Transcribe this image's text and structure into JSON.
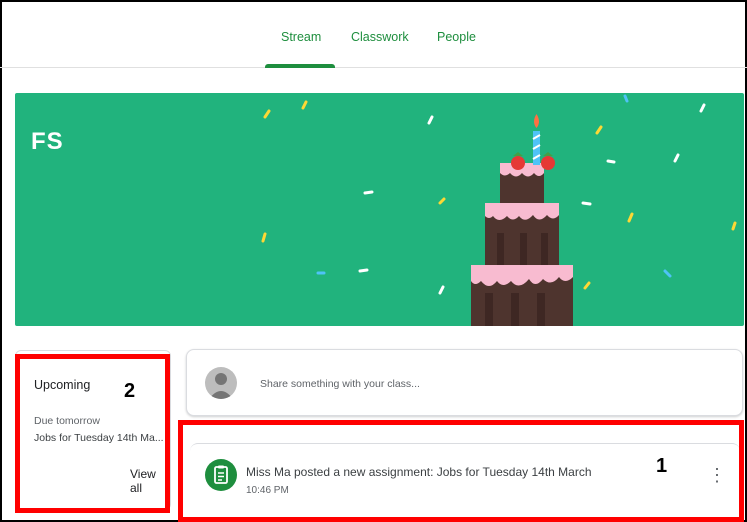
{
  "tabs": [
    {
      "label": "Stream",
      "active": true
    },
    {
      "label": "Classwork",
      "active": false
    },
    {
      "label": "People",
      "active": false
    }
  ],
  "banner": {
    "title": "FS",
    "color": "#21b37d"
  },
  "upcoming": {
    "title": "Upcoming",
    "due_label": "Due tomorrow",
    "item": "Jobs for Tuesday 14th Ma...",
    "view_all": "View all"
  },
  "share": {
    "placeholder": "Share something with your class..."
  },
  "post": {
    "title": "Miss Ma posted a new assignment: Jobs for Tuesday 14th March",
    "time": "10:46 PM",
    "icon": "assignment-icon"
  },
  "annotations": {
    "label_1": "1",
    "label_2": "2",
    "color": "#ff0000"
  },
  "colors": {
    "accent": "#1e8e3e",
    "banner": "#21b37d"
  }
}
